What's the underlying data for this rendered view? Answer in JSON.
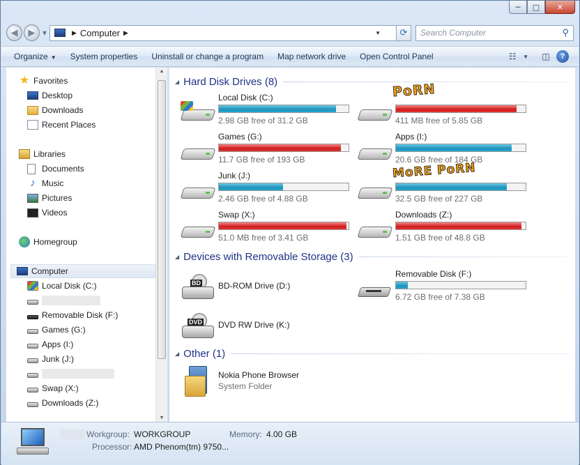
{
  "window": {
    "caption_min": "─",
    "caption_max": "□",
    "caption_close": "✕"
  },
  "address": {
    "crumb": "Computer",
    "search_placeholder": "Search Computer"
  },
  "toolbar": {
    "organize": "Organize",
    "system_properties": "System properties",
    "uninstall": "Uninstall or change a program",
    "map_drive": "Map network drive",
    "control_panel": "Open Control Panel"
  },
  "nav": {
    "favorites": "Favorites",
    "desktop": "Desktop",
    "downloads": "Downloads",
    "recent_places": "Recent Places",
    "libraries": "Libraries",
    "documents": "Documents",
    "music": "Music",
    "pictures": "Pictures",
    "videos": "Videos",
    "homegroup": "Homegroup",
    "computer": "Computer",
    "drives": [
      "Local Disk (C:)",
      "Removable Disk (F:)",
      "Games (G:)",
      "Apps (I:)",
      "Junk (J:)",
      "Swap (X:)",
      "Downloads (Z:)"
    ]
  },
  "groups": {
    "hdd": "Hard Disk Drives (8)",
    "removable": "Devices with Removable Storage (3)",
    "other": "Other (1)"
  },
  "hdd": [
    {
      "name": "Local Disk (C:)",
      "free": "2.98 GB free of 31.2 GB",
      "used_fraction": 0.905,
      "color": "blue"
    },
    {
      "name": "",
      "free": "411 MB free of 5.85 GB",
      "used_fraction": 0.93,
      "color": "red"
    },
    {
      "name": "Games (G:)",
      "free": "11.7 GB free of 193 GB",
      "used_fraction": 0.94,
      "color": "red"
    },
    {
      "name": "Apps (I:)",
      "free": "20.6 GB free of 184 GB",
      "used_fraction": 0.89,
      "color": "blue"
    },
    {
      "name": "Junk (J:)",
      "free": "2.46 GB free of 4.88 GB",
      "used_fraction": 0.495,
      "color": "blue"
    },
    {
      "name": "",
      "free": "32.5 GB free of 227 GB",
      "used_fraction": 0.857,
      "color": "blue"
    },
    {
      "name": "Swap (X:)",
      "free": "51.0 MB free of 3.41 GB",
      "used_fraction": 0.985,
      "color": "red"
    },
    {
      "name": "Downloads (Z:)",
      "free": "1.51 GB free of 48.8 GB",
      "used_fraction": 0.97,
      "color": "red"
    }
  ],
  "stickers": [
    "PoRN",
    "MoRE PoRN"
  ],
  "removable": {
    "bd": {
      "name": "BD-ROM Drive (D:)",
      "badge": "BD"
    },
    "dvd": {
      "name": "DVD RW Drive (K:)",
      "badge": "DVD"
    },
    "rdisk": {
      "name": "Removable Disk (F:)",
      "free": "6.72 GB free of 7.38 GB",
      "used_fraction": 0.09
    }
  },
  "other": {
    "name": "Nokia Phone Browser",
    "sub": "System Folder"
  },
  "details": {
    "workgroup_label": "Workgroup:",
    "workgroup_value": "WORKGROUP",
    "memory_label": "Memory:",
    "memory_value": "4.00 GB",
    "processor_label": "Processor:",
    "processor_value": "AMD Phenom(tm) 9750..."
  }
}
